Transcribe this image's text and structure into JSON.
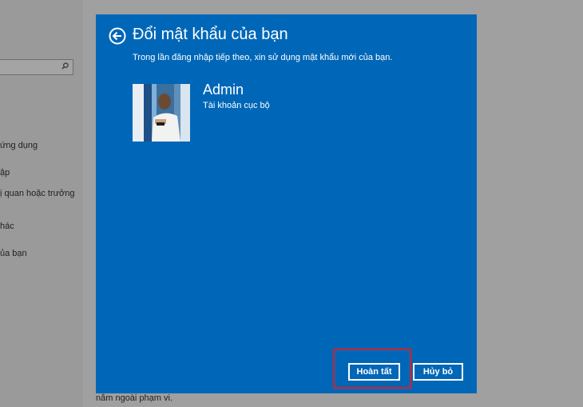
{
  "background": {
    "menu_items": [
      "ứng dụng",
      "ập",
      "ị quan hoặc trưởng",
      "hác",
      "ủa bạn"
    ],
    "bottom_text": "nằm ngoài phạm vi."
  },
  "dialog": {
    "title": "Đổi mật khẩu của bạn",
    "subtitle": "Trong lần đăng nhập tiếp theo, xin sử dụng mật khẩu mới của bạn.",
    "user": {
      "name": "Admin",
      "account_type": "Tài khoản cục bộ"
    },
    "buttons": {
      "finish_label": "Hoàn tất",
      "cancel_label": "Hủy bỏ"
    }
  },
  "colors": {
    "dialog_bg": "#0067b8",
    "highlight": "#d4202a"
  }
}
